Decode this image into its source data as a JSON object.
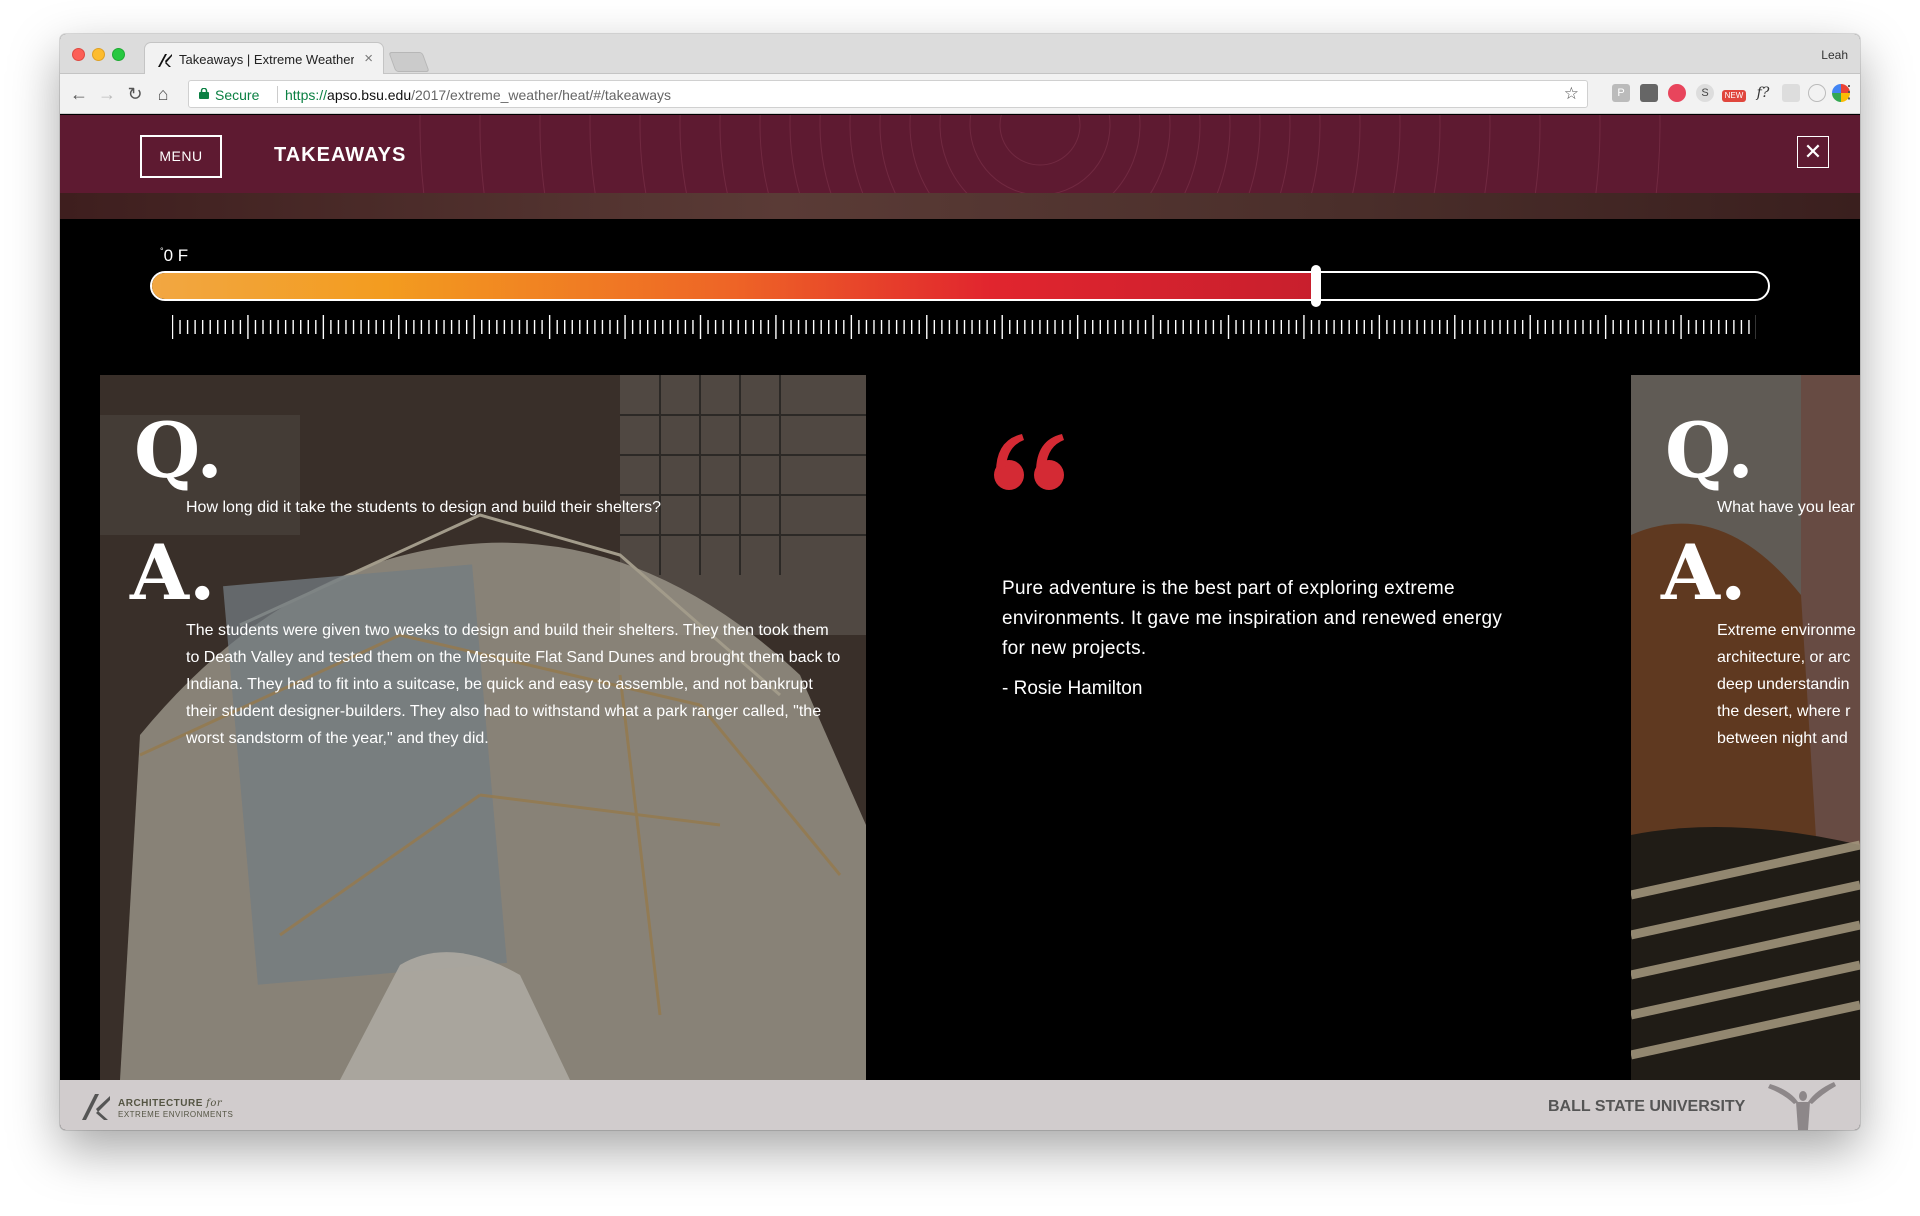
{
  "browser": {
    "tab_title": "Takeaways | Extreme Weather",
    "profile_name": "Leah",
    "secure_label": "Secure",
    "url_scheme": "https://",
    "url_host": "apso.bsu.edu",
    "url_path": "/2017/extreme_weather/heat/#/takeaways",
    "extensions": [
      "P",
      "S",
      "NEW",
      "f?"
    ]
  },
  "header": {
    "menu_label": "MENU",
    "title": "TAKEAWAYS",
    "close_label": "✕",
    "background_color": "#5e1a31"
  },
  "thermometer": {
    "label_unit": "0 F",
    "level_fraction": 0.72
  },
  "cards": {
    "left": {
      "q_letter": "Q.",
      "question": "How long did it take the students to design and build their shelters?",
      "a_letter": "A.",
      "answer": "The students were given two weeks to design and build their shelters. They then took them to Death Valley and tested them on the Mesquite Flat Sand Dunes and brought them back to Indiana. They had to fit into a suitcase, be quick and easy to assemble, and not bankrupt their student designer-builders. They also had to withstand what a park ranger called, \"the worst sandstorm of the year,\" and they did."
    },
    "quote": {
      "text": "Pure adventure is the best part of exploring extreme environments. It gave me inspiration and renewed energy for new projects.",
      "author": "- Rosie Hamilton",
      "accent_color": "#d42a34"
    },
    "right": {
      "q_letter": "Q.",
      "question": "What have you lear",
      "a_letter": "A.",
      "answer_lines": [
        "Extreme environme",
        "architecture, or arc",
        "deep understandin",
        "the desert, where r",
        "between night and"
      ]
    }
  },
  "footer": {
    "brand_top": "ARCHITECTURE",
    "brand_for": "for",
    "brand_sub": "EXTREME ENVIRONMENTS",
    "university": "BALL STATE UNIVERSITY"
  }
}
